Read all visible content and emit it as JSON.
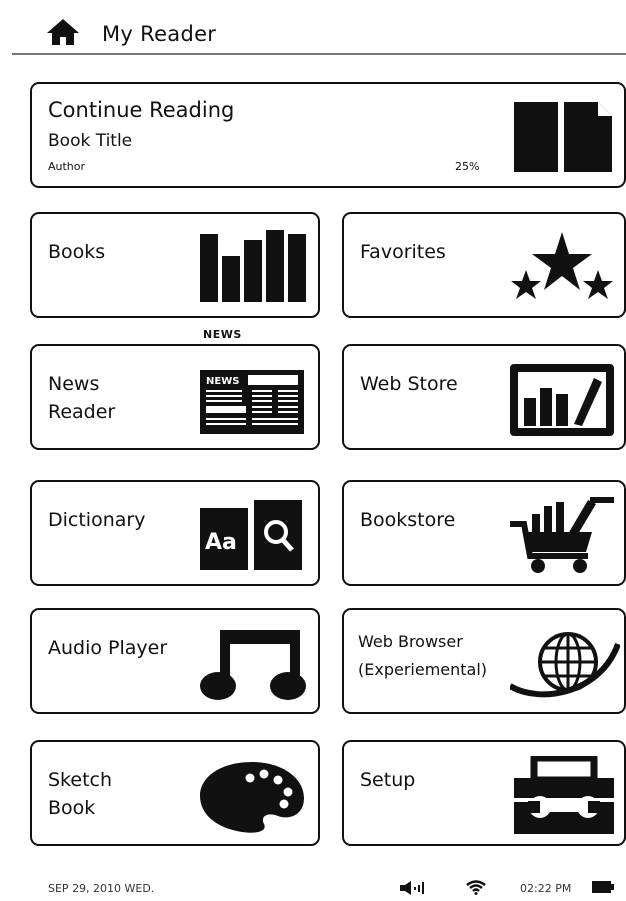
{
  "header": {
    "title": "My Reader"
  },
  "continue_reading": {
    "title": "Continue Reading",
    "book_title": "Book Title",
    "author": "Author",
    "progress": "25%"
  },
  "tiles": [
    {
      "label": "Books"
    },
    {
      "label": "Favorites"
    },
    {
      "label": "News\nReader",
      "caption": "NEWS",
      "icon_text": "NEWS"
    },
    {
      "label": "Web Store"
    },
    {
      "label": "Dictionary",
      "icon_text": "Aa"
    },
    {
      "label": "Bookstore"
    },
    {
      "label": "Audio Player"
    },
    {
      "label": "Web Browser\n(Experiemental)"
    },
    {
      "label": "Sketch\nBook"
    },
    {
      "label": "Setup"
    }
  ],
  "status_bar": {
    "date": "SEP 29, 2010  WED.",
    "time": "02:22 PM"
  }
}
